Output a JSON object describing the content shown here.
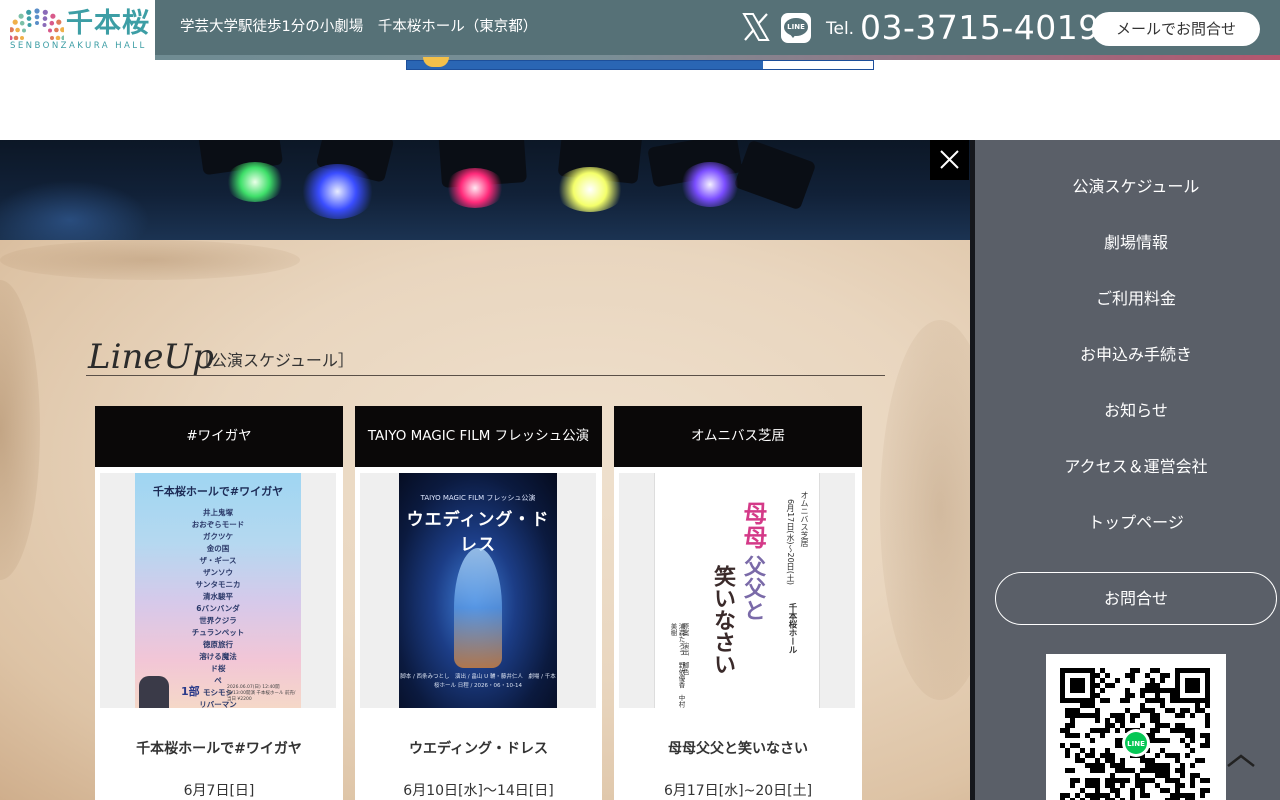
{
  "header": {
    "logo_text": "千本桜",
    "logo_sub": "SENBONZAKURA HALL",
    "tagline": "学芸大学駅徒歩1分の小劇場　千本桜ホール（東京都）",
    "x_icon": "x-logo-icon",
    "line_icon": "line-icon",
    "line_icon_text": "LINE",
    "tel_label": "Tel.",
    "tel_number": "03-3715-4019",
    "mail_button": "メールでお問合せ"
  },
  "lineup": {
    "title": "LineUp",
    "subtitle": "［公演スケジュール］",
    "cards": [
      {
        "header": "#ワイガヤ",
        "title": "千本桜ホールで#ワイガヤ",
        "date": "6月7日[日]",
        "poster": {
          "heading": "千本桜ホールで#ワイガヤ",
          "acts": [
            "井上鬼塚",
            "おおぞらモード",
            "ガクツケ",
            "金の国",
            "ザ・ギース",
            "ザンソウ",
            "サンタモニカ",
            "清水駿平",
            "6バンバンダ",
            "世界クジラ",
            "チュランペット",
            "徳原旅行",
            "溶ける魔法",
            "ド桜",
            "ペ",
            "モシモシ",
            "リバーマン"
          ],
          "part": "1部",
          "details": "2026.06.07(日) 12:40開場/13:00開演 千本桜ホール 前売/当日 ¥2200"
        }
      },
      {
        "header": "TAIYO MAGIC FILM フレッシュ公演",
        "title": "ウエディング・ドレス",
        "date": "6月10日[水]〜14日[日]",
        "poster": {
          "top": "TAIYO MAGIC FILM フレッシュ公演",
          "title": "ウエディング・ドレス",
          "credits": "脚本 / 西条みつとし　演出 / 畠山 U 輔・藤井仁人　劇場 / 千本桜ホール 日程 / 2026・06・10-14"
        }
      },
      {
        "header": "オムニバス芝居",
        "title": "母母父父と笑いなさい",
        "date": "6月17日[水]~20日[土]",
        "poster": {
          "label": "オムニバス芝居",
          "dates": "6月17日(水)〜20日(土)",
          "venue": "千本桜ホール",
          "title_a": "母母",
          "title_b": "父父と",
          "title_c": "笑いなさい",
          "credits_a": "原案　演出　脚色",
          "credits_b": "浦森たろう　野依優香　中村美樹"
        }
      }
    ]
  },
  "menu": {
    "items": [
      "公演スケジュール",
      "劇場情報",
      "ご利用料金",
      "お申込み手続き",
      "お知らせ",
      "アクセス＆運営会社",
      "トップページ"
    ],
    "contact": "お問合せ",
    "qr_label": "LINE"
  },
  "colors": {
    "header_bg": "#567177",
    "logo_accent": "#3d9ea5",
    "menu_bg": "#5a5f68",
    "card_header_bg": "#0a0808"
  }
}
